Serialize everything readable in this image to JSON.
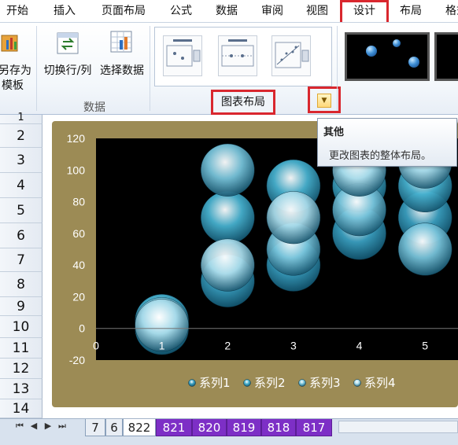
{
  "ribbon_tabs": [
    {
      "label": "开始"
    },
    {
      "label": "插入"
    },
    {
      "label": "页面布局"
    },
    {
      "label": "公式"
    },
    {
      "label": "数据"
    },
    {
      "label": "审阅"
    },
    {
      "label": "视图"
    },
    {
      "label": "设计",
      "active": true
    },
    {
      "label": "布局"
    },
    {
      "label": "格式"
    }
  ],
  "ribbon": {
    "save_template": {
      "line1": "另存为",
      "line2": "模板"
    },
    "switch_row_col": "切换行/列",
    "select_data": "选择数据",
    "group_data": "数据",
    "group_chart_layout": "图表布局"
  },
  "tooltip": {
    "title": "其他",
    "body": "更改图表的整体布局。"
  },
  "row_numbers": [
    "1",
    "2",
    "3",
    "4",
    "5",
    "6",
    "7",
    "8",
    "9",
    "10",
    "11",
    "12",
    "13",
    "14"
  ],
  "sheet_tabs": [
    {
      "label": "7",
      "style": "normal"
    },
    {
      "label": "6",
      "style": "normal"
    },
    {
      "label": "822",
      "style": "current"
    },
    {
      "label": "821",
      "style": "purple"
    },
    {
      "label": "820",
      "style": "purple"
    },
    {
      "label": "819",
      "style": "purple"
    },
    {
      "label": "818",
      "style": "purple"
    },
    {
      "label": "817",
      "style": "purple"
    }
  ],
  "colors": {
    "accent_red": "#d9272e",
    "chart_frame": "#9c8b55",
    "plot_background": "#000000",
    "sheet_tab_purple": "#7d2fc6"
  },
  "icons": [
    "save-as-template-icon",
    "switch-row-column-icon",
    "select-data-icon",
    "gallery-more-icon",
    "sheet-nav-arrows-icon"
  ],
  "chart_data": {
    "type": "scatter",
    "variant": "bubble",
    "x_ticks": [
      "0",
      "1",
      "2",
      "3",
      "4",
      "5"
    ],
    "y_ticks": [
      "-20",
      "0",
      "20",
      "40",
      "60",
      "80",
      "100",
      "120"
    ],
    "xlim": [
      0,
      5.5
    ],
    "ylim": [
      -20,
      120
    ],
    "grid": false,
    "legend_position": "bottom",
    "series": [
      {
        "name": "系列1",
        "color": "#3a9fc0",
        "points": [
          {
            "x": 1,
            "y": 0
          },
          {
            "x": 2,
            "y": 30
          },
          {
            "x": 3,
            "y": 40
          },
          {
            "x": 4,
            "y": 60
          },
          {
            "x": 5,
            "y": 70
          }
        ]
      },
      {
        "name": "系列2",
        "color": "#47b1cf",
        "points": [
          {
            "x": 1,
            "y": 5
          },
          {
            "x": 2,
            "y": 70
          },
          {
            "x": 3,
            "y": 90
          },
          {
            "x": 4,
            "y": 90
          },
          {
            "x": 5,
            "y": 90
          }
        ]
      },
      {
        "name": "系列3",
        "color": "#78c4db",
        "points": [
          {
            "x": 1,
            "y": 3
          },
          {
            "x": 2,
            "y": 100
          },
          {
            "x": 3,
            "y": 50
          },
          {
            "x": 4,
            "y": 75
          },
          {
            "x": 5,
            "y": 50
          }
        ]
      },
      {
        "name": "系列4",
        "color": "#a8dbea",
        "points": [
          {
            "x": 1,
            "y": 2
          },
          {
            "x": 2,
            "y": 40
          },
          {
            "x": 3,
            "y": 70
          },
          {
            "x": 4,
            "y": 100
          },
          {
            "x": 5,
            "y": 105
          }
        ]
      }
    ]
  }
}
